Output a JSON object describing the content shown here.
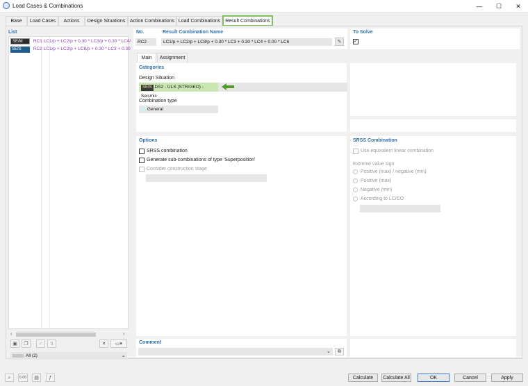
{
  "window": {
    "title": "Load Cases & Combinations",
    "minimize": "—",
    "maximize": "☐",
    "close": "✕"
  },
  "tabs": [
    {
      "label": "Base"
    },
    {
      "label": "Load Cases"
    },
    {
      "label": "Actions"
    },
    {
      "label": "Design Situations"
    },
    {
      "label": "Action Combinations"
    },
    {
      "label": "Load Combinations"
    },
    {
      "label": "Result Combinations"
    }
  ],
  "list": {
    "title": "List",
    "items": [
      {
        "badge": "SE/M",
        "code": "RC1",
        "text": "LC1/p + LC2/p + 0.30 * LC3/p + 0.30 * LC4/"
      },
      {
        "badge": "SEIS",
        "code": "RC2",
        "text": "LC1/p + LC2/p + LC8/p + 0.30 * LC3 + 0.30"
      }
    ],
    "filter": "All (2)"
  },
  "header": {
    "no_label": "No.",
    "no_value": "RC2",
    "name_label": "Result Combination Name",
    "name_value": "LC1/p + LC2/p + LC8/p + 0.30 * LC3 + 0.30 * LC4 + 0.00 * LC6",
    "to_solve_label": "To Solve",
    "to_solve_checked": "✓"
  },
  "subtabs": [
    {
      "label": "Main"
    },
    {
      "label": "Assignment"
    }
  ],
  "categories": {
    "title": "Categories",
    "design_situation_label": "Design Situation",
    "design_situation_badge": "SEIS",
    "design_situation_value": "DS2 - ULS (STR/GEO) - Seismic",
    "combination_type_label": "Combination type",
    "combination_type_value": "General"
  },
  "options": {
    "title": "Options",
    "srss": "SRSS combination",
    "superposition": "Generate sub-combinations of type 'Superposition'",
    "construction_stage": "Consider construction stage"
  },
  "srss": {
    "title": "SRSS Combination",
    "equivalent_linear": "Use equivalent linear combination",
    "extreme_label": "Extreme value sign",
    "radios": [
      "Positive (max) / negative (min)",
      "Positive (max)",
      "Negative (min)",
      "According to LC/CO"
    ]
  },
  "comment": {
    "title": "Comment"
  },
  "footer": {
    "calculate": "Calculate",
    "calculate_all": "Calculate All",
    "ok": "OK",
    "cancel": "Cancel",
    "apply": "Apply"
  },
  "colors": {
    "accent": "#2f6fae",
    "active_tab_border": "#7fc15a",
    "arrow": "#4e9a2a",
    "highlight": "#c9e6b3"
  }
}
